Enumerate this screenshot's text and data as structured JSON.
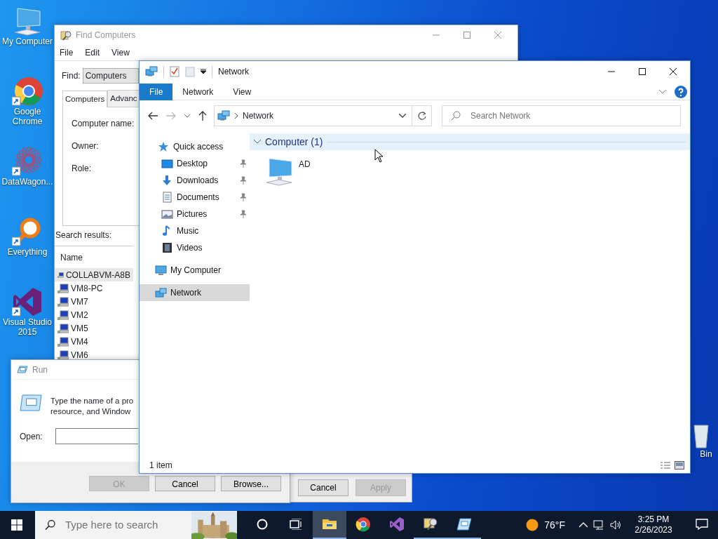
{
  "desktop_icons": [
    {
      "label": "My Computer",
      "kind": "computer",
      "shortcut": false
    },
    {
      "label": "Google Chrome",
      "kind": "chrome",
      "shortcut": true
    },
    {
      "label": "DataWagon...",
      "kind": "web",
      "shortcut": true
    },
    {
      "label": "Everything",
      "kind": "magnifier",
      "shortcut": true
    },
    {
      "label": "Visual Studio 2015",
      "kind": "vs",
      "shortcut": true
    }
  ],
  "recycle_bin": {
    "label": "Bin"
  },
  "find_window": {
    "title": "Find Computers",
    "menu": [
      "File",
      "Edit",
      "View"
    ],
    "find_label": "Find:",
    "find_value": "Computers",
    "tabs": [
      {
        "label": "Computers",
        "selected": true
      },
      {
        "label": "Advanc",
        "selected": false
      }
    ],
    "fields": [
      "Computer name:",
      "Owner:",
      "Role:"
    ],
    "results_label": "Search results:",
    "column": "Name",
    "rows": [
      {
        "name": "COLLABVM-A8B",
        "selected": true
      },
      {
        "name": "VM8-PC",
        "selected": false
      },
      {
        "name": "VM7",
        "selected": false
      },
      {
        "name": "VM2",
        "selected": false
      },
      {
        "name": "VM5",
        "selected": false
      },
      {
        "name": "VM4",
        "selected": false
      },
      {
        "name": "VM6",
        "selected": false
      }
    ]
  },
  "dialog_buttons": [
    {
      "label": "Cancel",
      "disabled": false
    },
    {
      "label": "Apply",
      "disabled": true
    }
  ],
  "run_window": {
    "title": "Run",
    "message_lines": [
      "Type the name of a pro",
      "resource, and Window"
    ],
    "open_label": "Open:",
    "buttons": [
      {
        "label": "OK",
        "disabled": true
      },
      {
        "label": "Cancel",
        "disabled": false
      },
      {
        "label": "Browse...",
        "disabled": false
      }
    ]
  },
  "explorer": {
    "title": "Network",
    "ribbon_tabs": [
      {
        "label": "File",
        "selected": true
      },
      {
        "label": "Network",
        "selected": false
      },
      {
        "label": "View",
        "selected": false
      }
    ],
    "address": "Network",
    "search": {
      "placeholder": "Search Network"
    },
    "nav": [
      {
        "label": "Quick access",
        "kind": "star",
        "selected": false,
        "children": [
          {
            "label": "Desktop",
            "kind": "desktop",
            "pinned": true,
            "selected": false
          },
          {
            "label": "Downloads",
            "kind": "download",
            "pinned": true,
            "selected": false
          },
          {
            "label": "Documents",
            "kind": "document",
            "pinned": true,
            "selected": false
          },
          {
            "label": "Pictures",
            "kind": "pictures",
            "pinned": true,
            "selected": false
          },
          {
            "label": "Music",
            "kind": "music",
            "pinned": false,
            "selected": false
          },
          {
            "label": "Videos",
            "kind": "video",
            "pinned": false,
            "selected": false
          }
        ]
      },
      {
        "label": "My Computer",
        "kind": "computer",
        "selected": false
      },
      {
        "label": "Network",
        "kind": "network",
        "selected": true
      }
    ],
    "group": {
      "label": "Computer (1)",
      "expanded": true
    },
    "items": [
      {
        "label": "AD"
      }
    ],
    "status": "1 item"
  },
  "taskbar": {
    "search_placeholder": "Type here to search",
    "apps": [
      {
        "kind": "explorer",
        "running": true,
        "active": true
      },
      {
        "kind": "chrome",
        "running": false,
        "active": false
      },
      {
        "kind": "vs",
        "running": false,
        "active": false
      },
      {
        "kind": "find",
        "running": true,
        "active": false
      },
      {
        "kind": "run",
        "running": true,
        "active": false
      }
    ],
    "weather": "76°F",
    "time": "3:25 PM",
    "date": "2/26/2023"
  }
}
